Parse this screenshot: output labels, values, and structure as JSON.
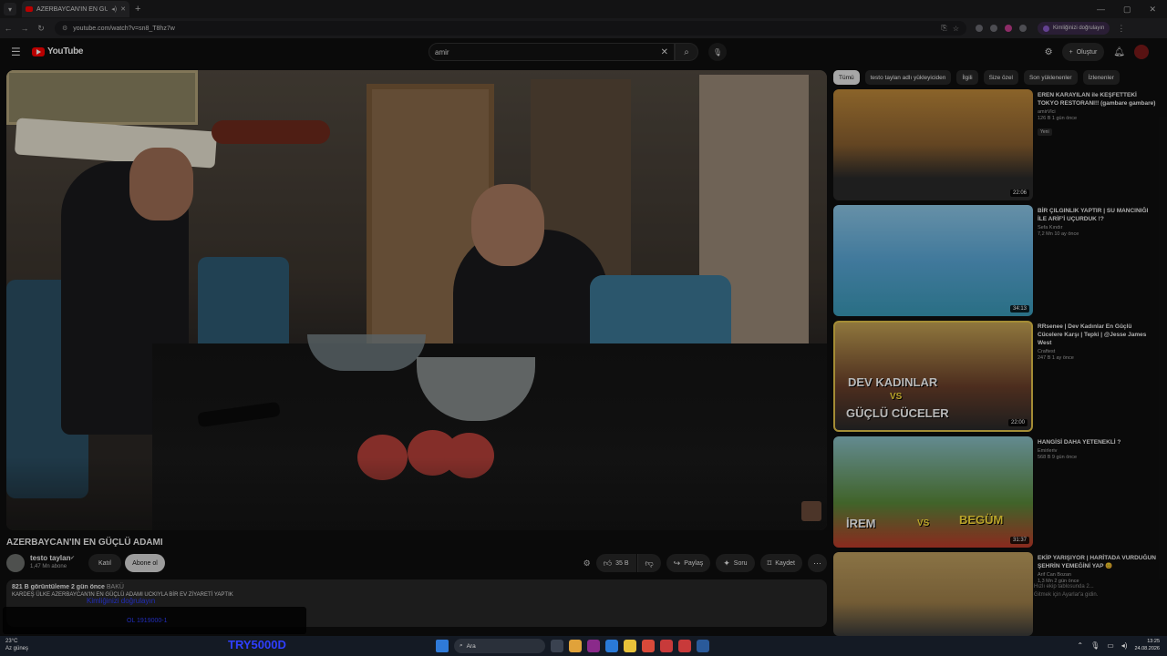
{
  "browser": {
    "tab_title": "AZERBAYCAN'IN EN GÜÇLÜ",
    "url": "youtube.com/watch?v=sn8_T8hz7w",
    "verify_label": "Kimliğinizi doğrulayın"
  },
  "header": {
    "logo_text": "YouTube",
    "search_value": "amir",
    "create_label": "Oluştur"
  },
  "video": {
    "title": "AZERBAYCAN'IN EN GÜÇLÜ ADAMI",
    "channel": "testo taylan",
    "subscribers": "1,47 Mn abone",
    "join_label": "Katıl",
    "subscribe_label": "Abone ol",
    "likes": "35 B",
    "share_label": "Paylaş",
    "ask_label": "Soru",
    "save_label": "Kaydet",
    "views_time": "821 B görüntüleme  2 gün önce",
    "location": "BAKÜ",
    "description": "KARDEŞ ÜLKE AZERBAYCAN'IN EN GÜÇLÜ ADAMI UCKIYLA BİR EV ZİYARETİ YAPTIK"
  },
  "chips": [
    "Tümü",
    "testo taylan adlı yükleyiciden",
    "İlgili",
    "Size özel",
    "Son yüklenenler",
    "İzlenenler"
  ],
  "recommendations": [
    {
      "title": "EREN KARAYILAN ile KEŞFETTEKİ TOKYO RESTORANI!! (gambare gambare)",
      "channel": "amirVlci",
      "meta": "126 B  1 gün önce",
      "badge": "Yeni",
      "duration": "22:06"
    },
    {
      "title": "BİR ÇILGINLIK YAPTIR | SU MANCINIĞI İLE ARİF'İ UÇURDUK !?",
      "channel": "Sefa Kındır",
      "meta": "7,2 Mn  10 ay önce",
      "duration": "34:13"
    },
    {
      "title": "RRsenee | Dev Kadınlar En Güçlü Cücelere Karşı | Tepki | @Jesse James West",
      "channel": "Craftest",
      "meta": "247 B  1 ay önce",
      "duration": "22:00",
      "caption1": "DEV KADINLAR",
      "caption2": "VS",
      "caption3": "GÜÇLÜ CÜCELER"
    },
    {
      "title": "HANGİSİ DAHA YETENEKLİ ?",
      "channel": "Emirleriv",
      "meta": "568 B  9 gün önce",
      "duration": "31:37",
      "caption1": "İREM",
      "caption2": "VS",
      "caption3": "BEGÜM"
    },
    {
      "title": "EKİP YARIŞIYOR | HARİTADA VURDUĞUN ŞEHRİN YEMEĞİNİ YAP 😊",
      "channel": "Arif Can Bozan",
      "meta": "1,3 Mn  2 gün önce",
      "duration": ""
    }
  ],
  "toast": {
    "line1": "Hızlı ekip tablosunda 2...",
    "line2": "Gitmek için Ayarlar'a gidin."
  },
  "overlay": {
    "line1": "Kimliğinizi doğrulayın",
    "line2": "OL 1919000-1",
    "taskbar_text": "TRY5000D"
  },
  "taskbar": {
    "weather_temp": "23°C",
    "weather_desc": "Az güneş",
    "search_label": "Ara",
    "time": "13:25",
    "date": "24.08.2026"
  }
}
